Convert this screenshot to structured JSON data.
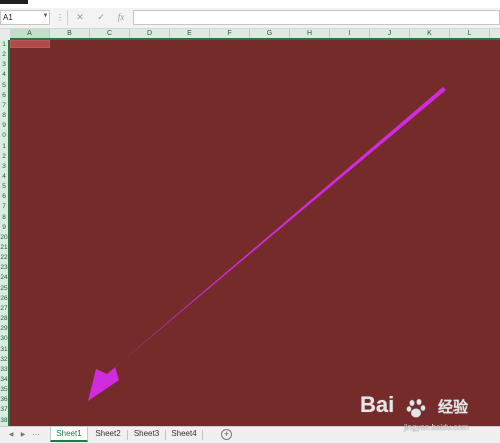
{
  "formula_bar": {
    "name_box_value": "A1",
    "cancel_icon": "✕",
    "enter_icon": "✓",
    "function_label": "fx",
    "formula_value": ""
  },
  "columns": [
    "A",
    "B",
    "C",
    "D",
    "E",
    "F",
    "G",
    "H",
    "I",
    "J",
    "K",
    "L"
  ],
  "rows": [
    "1",
    "2",
    "3",
    "4",
    "5",
    "6",
    "7",
    "8",
    "9",
    "0",
    "1",
    "2",
    "3",
    "4",
    "5",
    "6",
    "7",
    "8",
    "9",
    "20",
    "21",
    "22",
    "23",
    "24",
    "25",
    "26",
    "27",
    "28",
    "29",
    "30",
    "31",
    "32",
    "33",
    "34",
    "35",
    "36",
    "37",
    "38"
  ],
  "sheet_tabs": [
    {
      "label": "Sheet1",
      "active": true
    },
    {
      "label": "Sheet2",
      "active": false
    },
    {
      "label": "Sheet3",
      "active": false
    },
    {
      "label": "Sheet4",
      "active": false
    }
  ],
  "selected_cell": "A1",
  "colors": {
    "sheet_fill": "#762b2b",
    "accent": "#1f7a45",
    "annotation_arrow": "#d12be0"
  },
  "annotation": {
    "type": "arrow",
    "points_to": "sheet-tabs"
  },
  "watermark": {
    "brand": "Bai",
    "chinese": "经验",
    "url": "jingyan.baidu.com"
  }
}
